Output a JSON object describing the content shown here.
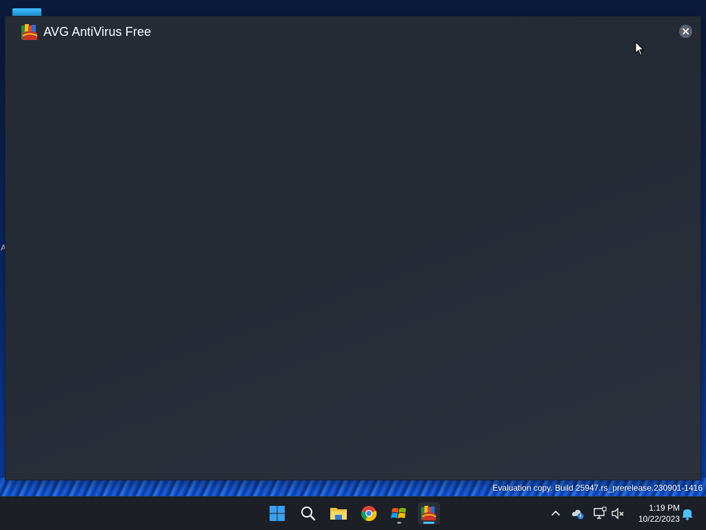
{
  "window": {
    "title": "AVG AntiVirus Free",
    "logo_icon": "avg-logo-icon",
    "close_icon": "close-icon",
    "background_color": "#262c36"
  },
  "desktop": {
    "edge_letter": "A",
    "watermark": "Evaluation copy. Build 25947.rs_prerelease.230901-1416"
  },
  "taskbar": {
    "apps": [
      {
        "name": "start-button",
        "icon": "windows-logo-icon"
      },
      {
        "name": "search-button",
        "icon": "search-icon"
      },
      {
        "name": "file-explorer-button",
        "icon": "folder-icon"
      },
      {
        "name": "chrome-button",
        "icon": "chrome-icon"
      },
      {
        "name": "windows-app-button",
        "icon": "windows-flag-icon",
        "running": true
      },
      {
        "name": "avg-button",
        "icon": "avg-logo-icon",
        "active": true
      }
    ],
    "tray": {
      "chevron_icon": "chevron-up-icon",
      "icons": [
        "cloud-status-icon",
        "network-icon",
        "volume-muted-icon"
      ],
      "time": "1:19 PM",
      "date": "10/22/2023",
      "notification_icon": "bell-icon"
    },
    "accent_color": "#4cc2ff"
  }
}
